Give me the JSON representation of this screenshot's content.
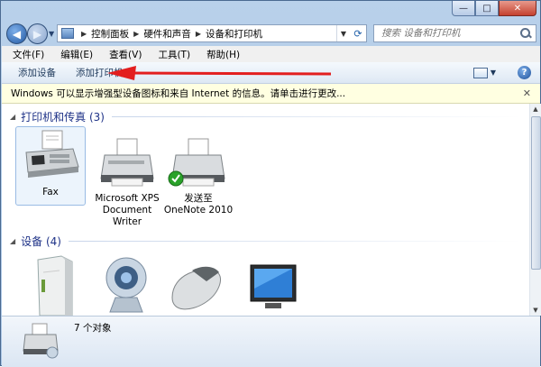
{
  "window": {
    "caption": {
      "minimize": "—",
      "maximize": "□",
      "close": "✕"
    }
  },
  "nav": {
    "back": "◀",
    "forward": "▶",
    "breadcrumbs": [
      "控制面板",
      "硬件和声音",
      "设备和打印机"
    ],
    "search_placeholder": "搜索 设备和打印机"
  },
  "menu": [
    "文件(F)",
    "编辑(E)",
    "查看(V)",
    "工具(T)",
    "帮助(H)"
  ],
  "commands": {
    "add_device": "添加设备",
    "add_printer": "添加打印机",
    "help": "?"
  },
  "infobar": {
    "message": "Windows 可以显示增强型设备图标和来自 Internet 的信息。请单击进行更改...",
    "close": "✕"
  },
  "groups": {
    "printers": {
      "title": "打印机和传真 (3)",
      "items": [
        {
          "label": "Fax",
          "icon": "fax-icon"
        },
        {
          "label": "Microsoft XPS Document Writer",
          "icon": "printer-icon"
        },
        {
          "label": "发送至 OneNote 2010",
          "icon": "printer-default-icon"
        }
      ]
    },
    "devices": {
      "title": "设备 (4)",
      "items": [
        {
          "icon": "computer-tower-icon"
        },
        {
          "icon": "webcam-icon"
        },
        {
          "icon": "mouse-icon"
        },
        {
          "icon": "monitor-icon"
        }
      ]
    }
  },
  "details": {
    "status": "7 个对象"
  },
  "colors": {
    "group_header": "#1e3287",
    "arrow": "#e31e1e",
    "infobar_bg": "#ffffe1"
  }
}
